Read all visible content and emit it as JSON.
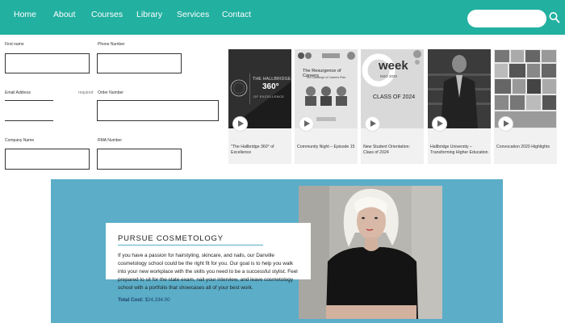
{
  "nav": {
    "items": [
      "Home",
      "About",
      "Courses",
      "Library",
      "Services",
      "Contact"
    ],
    "search_placeholder": ""
  },
  "form": {
    "first_name_label": "First name",
    "phone_label": "Phone Number",
    "email_label": "Email Address",
    "email_aside": "required",
    "order_label": "Order Number",
    "company_label": "Company Name",
    "rma_label": "RMA Number"
  },
  "videos": [
    {
      "title": "\"The Hallbridge 360° of Excellence"
    },
    {
      "title": "Community Night – Episode 15"
    },
    {
      "title": "New Student Orientation: Class of 2024"
    },
    {
      "title": "Hallbridge University – Transforming Higher Education"
    },
    {
      "title": "Convocation 2020 Highlights"
    }
  ],
  "thumbs": {
    "t1_text1": "THE HALLBRIDGE",
    "t1_text2": "360°",
    "t1_text3": "OF EXCELLENCE",
    "t2_text1": "The Resurgence of Careers",
    "t2_text2": "The Challenge of Careers Plan",
    "t3_text1": "week",
    "t3_text2": "NSO 2020",
    "t3_text3": "CLASS OF 2024"
  },
  "banner": {
    "title": "PURSUE COSMETOLOGY",
    "paragraph": "If you have a passion for hairstyling, skincare, and nails, our Danville cosmetology school could be the right fit for you. Our goal is to help you walk into your new workplace with the skills you need to be a successful stylist. Feel prepared to sit for the state exam, nail your interview, and leave cosmetology school with a portfolio that showcases all of your best work.",
    "cost_label": "Total Cost:",
    "cost_value": "$24,334.00"
  }
}
